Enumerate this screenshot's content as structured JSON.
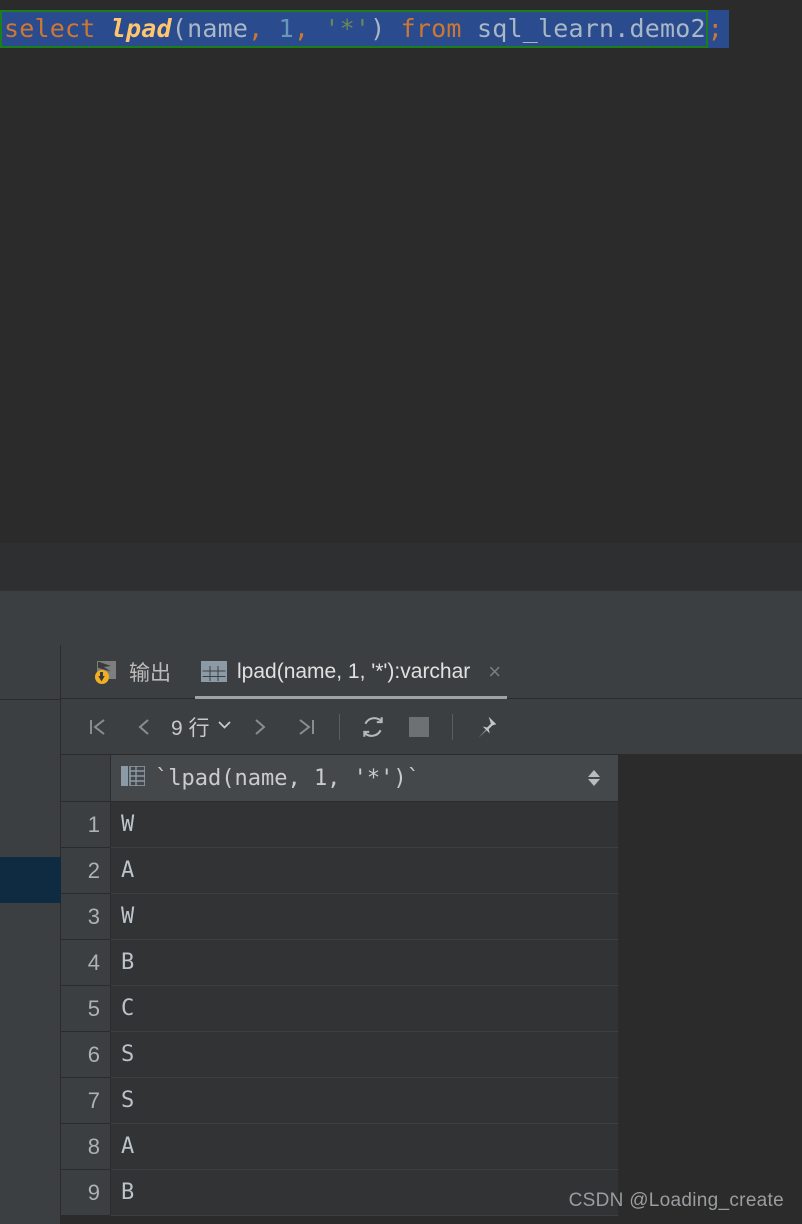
{
  "editor": {
    "query_tokens": [
      {
        "text": "select",
        "type": "kw"
      },
      {
        "text": " ",
        "type": "plain"
      },
      {
        "text": "lpad",
        "type": "fn"
      },
      {
        "text": "(",
        "type": "punct"
      },
      {
        "text": "name",
        "type": "plain"
      },
      {
        "text": ", ",
        "type": "kw"
      },
      {
        "text": "1",
        "type": "num"
      },
      {
        "text": ", ",
        "type": "kw"
      },
      {
        "text": "'*'",
        "type": "str"
      },
      {
        "text": ")",
        "type": "punct"
      },
      {
        "text": " ",
        "type": "plain"
      },
      {
        "text": "from",
        "type": "kw"
      },
      {
        "text": " ",
        "type": "plain"
      },
      {
        "text": "sql_learn.demo2",
        "type": "plain"
      }
    ],
    "select_part": "select lpad(name, 1, '*') from sql_learn.demo2",
    "statement_end": ";",
    "selection_color": "#2A4B8D",
    "selection_border_color": "#1A7F1A"
  },
  "results_panel": {
    "tabs": [
      {
        "id": "output",
        "label": "输出",
        "icon": "output-arrow-icon",
        "active": false,
        "closable": false
      },
      {
        "id": "result-grid",
        "label": "lpad(name, 1, '*'):varchar",
        "icon": "table-grid-icon",
        "active": true,
        "closable": true,
        "close_label": "×"
      }
    ],
    "toolbar": {
      "first_page_icon": "first-page-icon",
      "prev_page_icon": "prev-page-icon",
      "rows_label": "9 行",
      "rows_dropdown_icon": "chevron-down-icon",
      "next_page_icon": "next-page-icon",
      "last_page_icon": "last-page-icon",
      "reload_icon": "reload-icon",
      "stop_icon": "stop-icon",
      "pin_icon": "pin-icon"
    },
    "table": {
      "columns": [
        {
          "header": "`lpad(name, 1, '*')`",
          "icon": "column-type-icon",
          "sort_icon": "sort-updown-icon"
        }
      ],
      "rows": [
        {
          "n": "1",
          "value": "W"
        },
        {
          "n": "2",
          "value": "A"
        },
        {
          "n": "3",
          "value": "W"
        },
        {
          "n": "4",
          "value": "B"
        },
        {
          "n": "5",
          "value": "C"
        },
        {
          "n": "6",
          "value": "S"
        },
        {
          "n": "7",
          "value": "S"
        },
        {
          "n": "8",
          "value": "A"
        },
        {
          "n": "9",
          "value": "B"
        }
      ]
    }
  },
  "watermark": {
    "text": "CSDN @Loading_create"
  },
  "colors": {
    "editor_bg": "#2B2B2B",
    "panel_bg": "#3C3F41",
    "grid_bg": "#313335",
    "highlight_row": "#0F2B42",
    "keyword": "#CC7832",
    "function": "#FFC66D",
    "string": "#6A8759",
    "number": "#6897BB",
    "text": "#A9B7C6"
  }
}
